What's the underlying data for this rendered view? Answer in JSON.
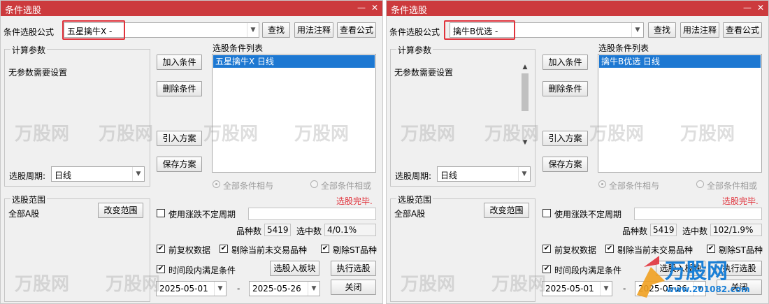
{
  "windows": [
    {
      "title": "条件选股",
      "formula_label": "条件选股公式",
      "formula_value": "五星擒牛X  -",
      "find_button": "查找",
      "usage_button": "用法注释",
      "view_formula_button": "查看公式",
      "params_group": "计算参数",
      "params_text": "无参数需要设置",
      "period_label": "选股周期:",
      "period_value": "日线",
      "add_button": "加入条件",
      "delete_button": "删除条件",
      "import_button": "引入方案",
      "save_button": "保存方案",
      "cond_list_label": "选股条件列表",
      "cond_items": [
        "五星擒牛X  日线"
      ],
      "radio_and": "全部条件相与",
      "radio_or": "全部条件相或",
      "status": "选股完毕.",
      "range_group": "选股范围",
      "range_value": "全部A股",
      "change_range_button": "改变范围",
      "use_period_checkbox": "使用涨跌不定周期",
      "count_label": "品种数",
      "count_value": "5419",
      "selected_label": "选中数",
      "selected_value": "4/0.1%",
      "fq_checkbox": "前复权数据",
      "exclude_untraded_checkbox": "剔除当前未交易品种",
      "exclude_st_checkbox": "剔除ST品种",
      "time_period_checkbox": "时间段内满足条件",
      "to_block_button": "选股入板块",
      "execute_button": "执行选股",
      "date_from": "2025-05-01",
      "date_sep": "-",
      "date_to": "2025-05-26",
      "close_button": "关闭"
    },
    {
      "title": "条件选股",
      "formula_label": "条件选股公式",
      "formula_value": "擒牛B优选  -",
      "find_button": "查找",
      "usage_button": "用法注释",
      "view_formula_button": "查看公式",
      "params_group": "计算参数",
      "params_text": "无参数需要设置",
      "period_label": "选股周期:",
      "period_value": "日线",
      "add_button": "加入条件",
      "delete_button": "删除条件",
      "import_button": "引入方案",
      "save_button": "保存方案",
      "cond_list_label": "选股条件列表",
      "cond_items": [
        "擒牛B优选  日线"
      ],
      "radio_and": "全部条件相与",
      "radio_or": "全部条件相或",
      "status": "选股完毕.",
      "range_group": "选股范围",
      "range_value": "全部A股",
      "change_range_button": "改变范围",
      "use_period_checkbox": "使用涨跌不定周期",
      "count_label": "品种数",
      "count_value": "5419",
      "selected_label": "选中数",
      "selected_value": "102/1.9%",
      "fq_checkbox": "前复权数据",
      "exclude_untraded_checkbox": "剔除当前未交易品种",
      "exclude_st_checkbox": "剔除ST品种",
      "time_period_checkbox": "时间段内满足条件",
      "to_block_button": "选股入板块",
      "execute_button": "执行选股",
      "date_from": "2025-05-01",
      "date_sep": "-",
      "date_to": "2025-05-26",
      "close_button": "关闭"
    }
  ],
  "watermark": {
    "brand": "万股网",
    "logo_text": "万股网",
    "url": "www.201082.com"
  },
  "colors": {
    "titlebar": "#cc3a3d",
    "highlight": "#e0333c",
    "selection": "#1d78d2",
    "status": "#e0333c"
  }
}
